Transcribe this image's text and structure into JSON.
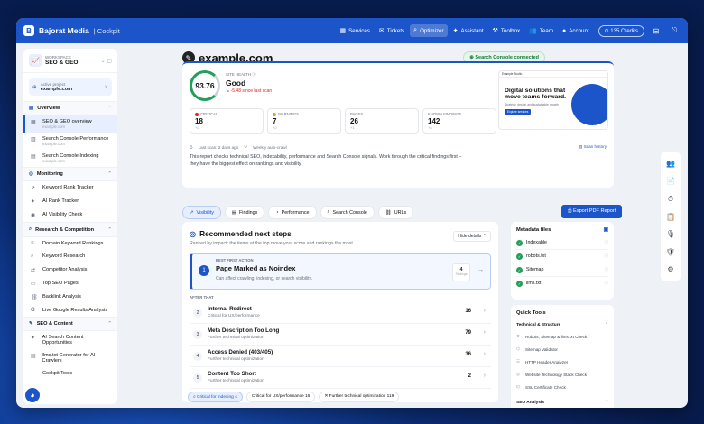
{
  "brand": {
    "name": "Bajorat Media",
    "sub": "| Cockpit"
  },
  "nav": [
    {
      "label": "Services",
      "icon": "▦",
      "active": false
    },
    {
      "label": "Tickets",
      "icon": "✉",
      "active": false
    },
    {
      "label": "Optimizer",
      "icon": "⌕",
      "active": true
    },
    {
      "label": "Assistant",
      "icon": "✦",
      "active": false
    },
    {
      "label": "Toolbox",
      "icon": "⚒",
      "active": false
    },
    {
      "label": "Team",
      "icon": "👥",
      "active": false
    },
    {
      "label": "Account",
      "icon": "●",
      "active": false
    }
  ],
  "credits": "⊙ 135 Credits",
  "workspace": {
    "label": "WORKSPACE",
    "value": "SEO & GEO"
  },
  "project": {
    "label": "Active project",
    "value": "example.com"
  },
  "sections": {
    "overview": "Overview",
    "monitoring": "Monitoring",
    "research": "Research & Competition",
    "content": "SEO & Content"
  },
  "overview_items": [
    {
      "label": "SEO & GEO overview",
      "sub": "example.com"
    },
    {
      "label": "Search Console Performance",
      "sub": "example.com"
    },
    {
      "label": "Search Console Indexing",
      "sub": "example.com"
    }
  ],
  "monitoring_items": [
    "Keyword Rank Tracker",
    "AI Rank Tracker",
    "AI Visibility Check"
  ],
  "research_items": [
    "Domain Keyword Rankings",
    "Keyword Research",
    "Competitor Analysis",
    "Top SEO Pages",
    "Backlink Analysis",
    "Live Google Results Analysis"
  ],
  "content_items": [
    "AI Search Content Opportunities",
    "llms.txt Generator for AI Crawlers",
    "Cockpit Tools"
  ],
  "domain": "example.com",
  "gsc": "⊕ Search Console connected",
  "health": {
    "score": "93.76",
    "label": "SITE HEALTH",
    "value": "Good",
    "delta": "↘ -5.48 since last scan"
  },
  "stats": [
    {
      "label": "CRITICAL",
      "value": "18",
      "sub": "+2",
      "color": "#dc2626"
    },
    {
      "label": "WARNINGS",
      "value": "7",
      "sub": "+2",
      "color": "#f59e0b"
    },
    {
      "label": "PAGES",
      "value": "26",
      "sub": "+1",
      "color": ""
    },
    {
      "label": "KNOWN FINDINGS",
      "value": "142",
      "sub": "+8",
      "color": ""
    }
  ],
  "promo": {
    "site": "Example Studio",
    "headline": "Digital solutions that move teams forward.",
    "sub": "Strategy, design and sustainable growth",
    "btn": "Explore services"
  },
  "scan": {
    "last": "Last scan: 2 days ago",
    "auto": "Weekly auto-crawl",
    "history": "Scan history"
  },
  "description": "This report checks technical SEO, indexability, performance and Search Console signals. Work through the critical findings first – they have the biggest effect on rankings and visibility.",
  "tabs": [
    "Visibility",
    "Findings",
    "Performance",
    "Search Console",
    "URLs"
  ],
  "export": "Export PDF Report",
  "steps": {
    "title": "Recommended next steps",
    "subtitle": "Ranked by impact: the items at the top move your score and rankings the most.",
    "hide": "Hide details ⌃",
    "best_label": "BEST FIRST ACTION",
    "best_title": "Page Marked as Noindex",
    "best_desc": "Can affect crawling, indexing, or search visibility.",
    "best_count": "4",
    "best_count_label": "Findings",
    "after": "AFTER THAT",
    "rows": [
      {
        "n": "2",
        "title": "Internal Redirect",
        "desc": "Critical for UX/performance",
        "count": "16"
      },
      {
        "n": "3",
        "title": "Meta Description Too Long",
        "desc": "Further technical optimization",
        "count": "79"
      },
      {
        "n": "4",
        "title": "Access Denied (403/405)",
        "desc": "Further technical optimization",
        "count": "36"
      },
      {
        "n": "5",
        "title": "Content Too Short",
        "desc": "Further technical optimization",
        "count": "2"
      }
    ]
  },
  "chips": [
    "⌕ Critical for indexing 4",
    "Critical for UX/performance 16",
    "✕ Further technical optimization 119"
  ],
  "meta": {
    "title": "Metadata files",
    "items": [
      "Indexable",
      "robots.txt",
      "Sitemap",
      "llms.txt"
    ]
  },
  "quick": {
    "title": "Quick Tools",
    "group1": "Technical & Structure",
    "items": [
      "Robots, Sitemap & llms.txt Check",
      "Sitemap Validator",
      "HTTP Header Analyzer",
      "Website Technology Stack Check",
      "SSL Certificate Check"
    ],
    "group2": "SEO Analysis"
  },
  "rail": [
    "👥",
    "📄",
    "⏱",
    "📋",
    "🎙",
    "🛡",
    "⚙"
  ]
}
